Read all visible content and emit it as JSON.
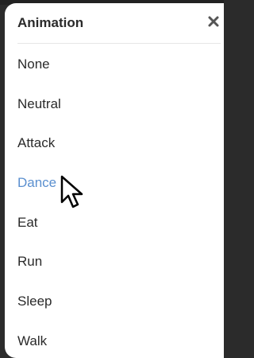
{
  "menu": {
    "title": "Animation",
    "close_icon": "close-icon",
    "items": [
      {
        "label": "None"
      },
      {
        "label": "Neutral"
      },
      {
        "label": "Attack"
      },
      {
        "label": "Dance"
      },
      {
        "label": "Eat"
      },
      {
        "label": "Run"
      },
      {
        "label": "Sleep"
      },
      {
        "label": "Walk"
      }
    ],
    "hovered_item": "Dance"
  },
  "colors": {
    "text": "#2a2a2a",
    "hover": "#5a8fcf",
    "background": "#2b2b2b",
    "panel": "#ffffff",
    "divider": "#e6e6e6"
  },
  "pointer_icon": "mouse-cursor-icon"
}
